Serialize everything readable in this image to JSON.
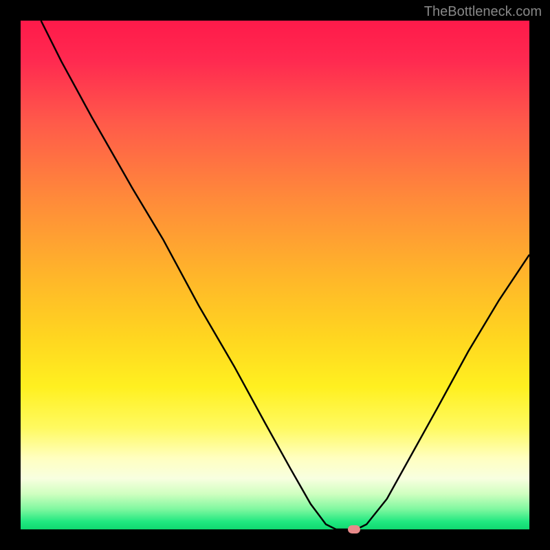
{
  "watermark": "TheBottleneck.com",
  "chart_data": {
    "type": "line",
    "title": "",
    "xlabel": "",
    "ylabel": "",
    "xlim": [
      0,
      100
    ],
    "ylim": [
      0,
      100
    ],
    "gradient_stops": [
      {
        "offset": 0.0,
        "color": "#ff1a4a"
      },
      {
        "offset": 0.08,
        "color": "#ff2a50"
      },
      {
        "offset": 0.2,
        "color": "#ff5a4a"
      },
      {
        "offset": 0.35,
        "color": "#ff8a3a"
      },
      {
        "offset": 0.5,
        "color": "#ffb52a"
      },
      {
        "offset": 0.62,
        "color": "#ffd520"
      },
      {
        "offset": 0.72,
        "color": "#fff020"
      },
      {
        "offset": 0.8,
        "color": "#fffa60"
      },
      {
        "offset": 0.86,
        "color": "#ffffc0"
      },
      {
        "offset": 0.9,
        "color": "#f8ffe0"
      },
      {
        "offset": 0.93,
        "color": "#d0ffc0"
      },
      {
        "offset": 0.96,
        "color": "#80f8a0"
      },
      {
        "offset": 0.985,
        "color": "#20e880"
      },
      {
        "offset": 1.0,
        "color": "#10d870"
      }
    ],
    "curve_points": [
      {
        "x": 4.0,
        "y": 100.0
      },
      {
        "x": 8.0,
        "y": 92.0
      },
      {
        "x": 14.0,
        "y": 81.0
      },
      {
        "x": 22.0,
        "y": 67.0
      },
      {
        "x": 28.0,
        "y": 57.0
      },
      {
        "x": 35.0,
        "y": 44.0
      },
      {
        "x": 42.0,
        "y": 32.0
      },
      {
        "x": 48.0,
        "y": 21.0
      },
      {
        "x": 53.0,
        "y": 12.0
      },
      {
        "x": 57.0,
        "y": 5.0
      },
      {
        "x": 60.0,
        "y": 1.0
      },
      {
        "x": 62.0,
        "y": 0.0
      },
      {
        "x": 66.0,
        "y": 0.0
      },
      {
        "x": 68.0,
        "y": 1.0
      },
      {
        "x": 72.0,
        "y": 6.0
      },
      {
        "x": 77.0,
        "y": 15.0
      },
      {
        "x": 82.0,
        "y": 24.0
      },
      {
        "x": 88.0,
        "y": 35.0
      },
      {
        "x": 94.0,
        "y": 45.0
      },
      {
        "x": 100.0,
        "y": 54.0
      }
    ],
    "marker": {
      "x": 65.5,
      "y": 0.0,
      "color": "#e88a8a"
    }
  }
}
